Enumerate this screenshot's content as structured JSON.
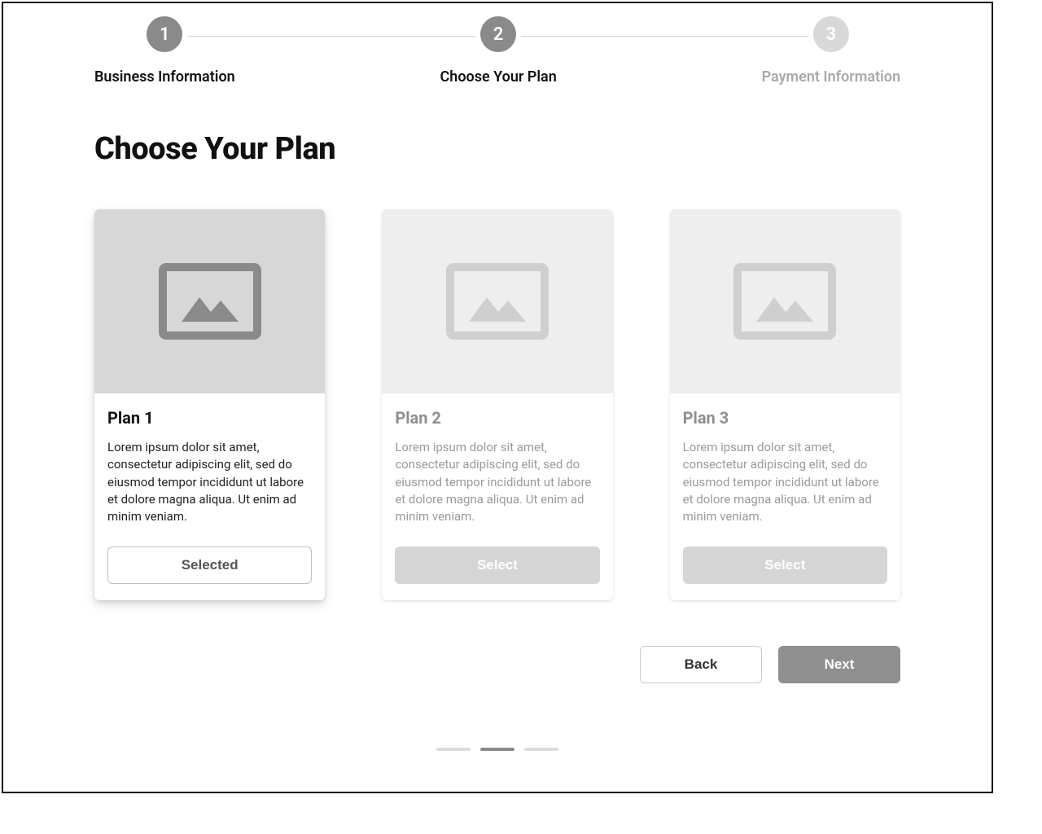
{
  "stepper": {
    "steps": [
      {
        "number": "1",
        "label": "Business Information",
        "active": true
      },
      {
        "number": "2",
        "label": "Choose Your Plan",
        "active": true
      },
      {
        "number": "3",
        "label": "Payment Information",
        "active": false
      }
    ]
  },
  "heading": "Choose Your Plan",
  "plans": [
    {
      "title": "Plan 1",
      "description": "Lorem ipsum dolor sit amet, consectetur adipiscing elit, sed do eiusmod tempor incididunt ut labore et dolore magna aliqua. Ut enim ad minim veniam.",
      "button_label": "Selected",
      "selected": true
    },
    {
      "title": "Plan 2",
      "description": "Lorem ipsum dolor sit amet, consectetur adipiscing elit, sed do eiusmod tempor incididunt ut labore et dolore magna aliqua. Ut enim ad minim veniam.",
      "button_label": "Select",
      "selected": false
    },
    {
      "title": "Plan 3",
      "description": "Lorem ipsum dolor sit amet, consectetur adipiscing elit, sed do eiusmod tempor incididunt ut labore et dolore magna aliqua. Ut enim ad minim veniam.",
      "button_label": "Select",
      "selected": false
    }
  ],
  "nav": {
    "back_label": "Back",
    "next_label": "Next"
  },
  "page_indicator": {
    "count": 3,
    "active_index": 1
  },
  "icons": {
    "image_placeholder": "image-placeholder-icon"
  }
}
